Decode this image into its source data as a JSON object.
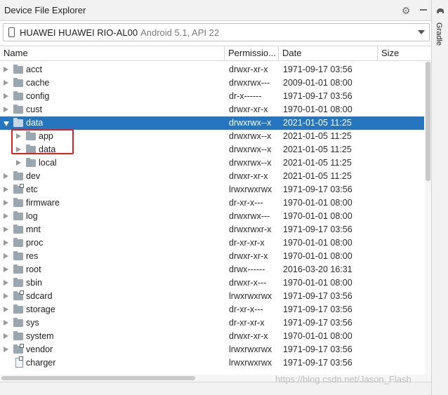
{
  "panel": {
    "title": "Device File Explorer",
    "settings_icon": "gear-icon",
    "minimize_icon": "minimize-icon"
  },
  "side_tab": {
    "label": "Gradle",
    "icon": "elephant-icon"
  },
  "device": {
    "name": "HUAWEI HUAWEI RIO-AL00",
    "api": "Android 5.1, API 22",
    "icon": "phone-icon"
  },
  "columns": {
    "name": "Name",
    "permissions": "Permissio...",
    "date": "Date",
    "size": "Size"
  },
  "rows": [
    {
      "name": "acct",
      "perm": "drwxr-xr-x",
      "date": "1971-09-17 03:56",
      "size": "",
      "depth": 0,
      "expander": "closed",
      "icon": "folder",
      "link": false,
      "selected": false
    },
    {
      "name": "cache",
      "perm": "drwxrwx---",
      "date": "2009-01-01 08:00",
      "size": "",
      "depth": 0,
      "expander": "closed",
      "icon": "folder",
      "link": false,
      "selected": false
    },
    {
      "name": "config",
      "perm": "dr-x------",
      "date": "1971-09-17 03:56",
      "size": "",
      "depth": 0,
      "expander": "closed",
      "icon": "folder",
      "link": false,
      "selected": false
    },
    {
      "name": "cust",
      "perm": "drwxr-xr-x",
      "date": "1970-01-01 08:00",
      "size": "",
      "depth": 0,
      "expander": "closed",
      "icon": "folder",
      "link": false,
      "selected": false
    },
    {
      "name": "data",
      "perm": "drwxrwx--x",
      "date": "2021-01-05 11:25",
      "size": "",
      "depth": 0,
      "expander": "open",
      "icon": "folder",
      "link": false,
      "selected": true
    },
    {
      "name": "app",
      "perm": "drwxrwx--x",
      "date": "2021-01-05 11:25",
      "size": "",
      "depth": 1,
      "expander": "closed",
      "icon": "folder",
      "link": false,
      "selected": false
    },
    {
      "name": "data",
      "perm": "drwxrwx--x",
      "date": "2021-01-05 11:25",
      "size": "",
      "depth": 1,
      "expander": "closed",
      "icon": "folder",
      "link": false,
      "selected": false
    },
    {
      "name": "local",
      "perm": "drwxrwx--x",
      "date": "2021-01-05 11:25",
      "size": "",
      "depth": 1,
      "expander": "closed",
      "icon": "folder",
      "link": false,
      "selected": false
    },
    {
      "name": "dev",
      "perm": "drwxr-xr-x",
      "date": "2021-01-05 11:25",
      "size": "",
      "depth": 0,
      "expander": "closed",
      "icon": "folder",
      "link": false,
      "selected": false
    },
    {
      "name": "etc",
      "perm": "lrwxrwxrwx",
      "date": "1971-09-17 03:56",
      "size": "",
      "depth": 0,
      "expander": "closed",
      "icon": "folder",
      "link": true,
      "selected": false
    },
    {
      "name": "firmware",
      "perm": "dr-xr-x---",
      "date": "1970-01-01 08:00",
      "size": "",
      "depth": 0,
      "expander": "closed",
      "icon": "folder",
      "link": false,
      "selected": false
    },
    {
      "name": "log",
      "perm": "drwxrwx---",
      "date": "1970-01-01 08:00",
      "size": "",
      "depth": 0,
      "expander": "closed",
      "icon": "folder",
      "link": false,
      "selected": false
    },
    {
      "name": "mnt",
      "perm": "drwxrwxr-x",
      "date": "1971-09-17 03:56",
      "size": "",
      "depth": 0,
      "expander": "closed",
      "icon": "folder",
      "link": false,
      "selected": false
    },
    {
      "name": "proc",
      "perm": "dr-xr-xr-x",
      "date": "1970-01-01 08:00",
      "size": "",
      "depth": 0,
      "expander": "closed",
      "icon": "folder",
      "link": false,
      "selected": false
    },
    {
      "name": "res",
      "perm": "drwxr-xr-x",
      "date": "1970-01-01 08:00",
      "size": "",
      "depth": 0,
      "expander": "closed",
      "icon": "folder",
      "link": false,
      "selected": false
    },
    {
      "name": "root",
      "perm": "drwx------",
      "date": "2016-03-20 16:31",
      "size": "",
      "depth": 0,
      "expander": "closed",
      "icon": "folder",
      "link": false,
      "selected": false
    },
    {
      "name": "sbin",
      "perm": "drwxr-x---",
      "date": "1970-01-01 08:00",
      "size": "",
      "depth": 0,
      "expander": "closed",
      "icon": "folder",
      "link": false,
      "selected": false
    },
    {
      "name": "sdcard",
      "perm": "lrwxrwxrwx",
      "date": "1971-09-17 03:56",
      "size": "",
      "depth": 0,
      "expander": "closed",
      "icon": "folder",
      "link": true,
      "selected": false
    },
    {
      "name": "storage",
      "perm": "dr-xr-x---",
      "date": "1971-09-17 03:56",
      "size": "",
      "depth": 0,
      "expander": "closed",
      "icon": "folder",
      "link": false,
      "selected": false
    },
    {
      "name": "sys",
      "perm": "dr-xr-xr-x",
      "date": "1971-09-17 03:56",
      "size": "",
      "depth": 0,
      "expander": "closed",
      "icon": "folder",
      "link": false,
      "selected": false
    },
    {
      "name": "system",
      "perm": "drwxr-xr-x",
      "date": "1970-01-01 08:00",
      "size": "",
      "depth": 0,
      "expander": "closed",
      "icon": "folder",
      "link": false,
      "selected": false
    },
    {
      "name": "vendor",
      "perm": "lrwxrwxrwx",
      "date": "1971-09-17 03:56",
      "size": "",
      "depth": 0,
      "expander": "closed",
      "icon": "folder",
      "link": true,
      "selected": false
    },
    {
      "name": "charger",
      "perm": "lrwxrwxrwx",
      "date": "1971-09-17 03:56",
      "size": "",
      "depth": 0,
      "expander": "none",
      "icon": "file",
      "link": true,
      "selected": false
    }
  ],
  "watermark": "https://blog.csdn.net/Jason_Flash",
  "colors": {
    "selection": "#2675bf",
    "highlight_box": "#e02020",
    "folder": "#9aa6b0"
  }
}
